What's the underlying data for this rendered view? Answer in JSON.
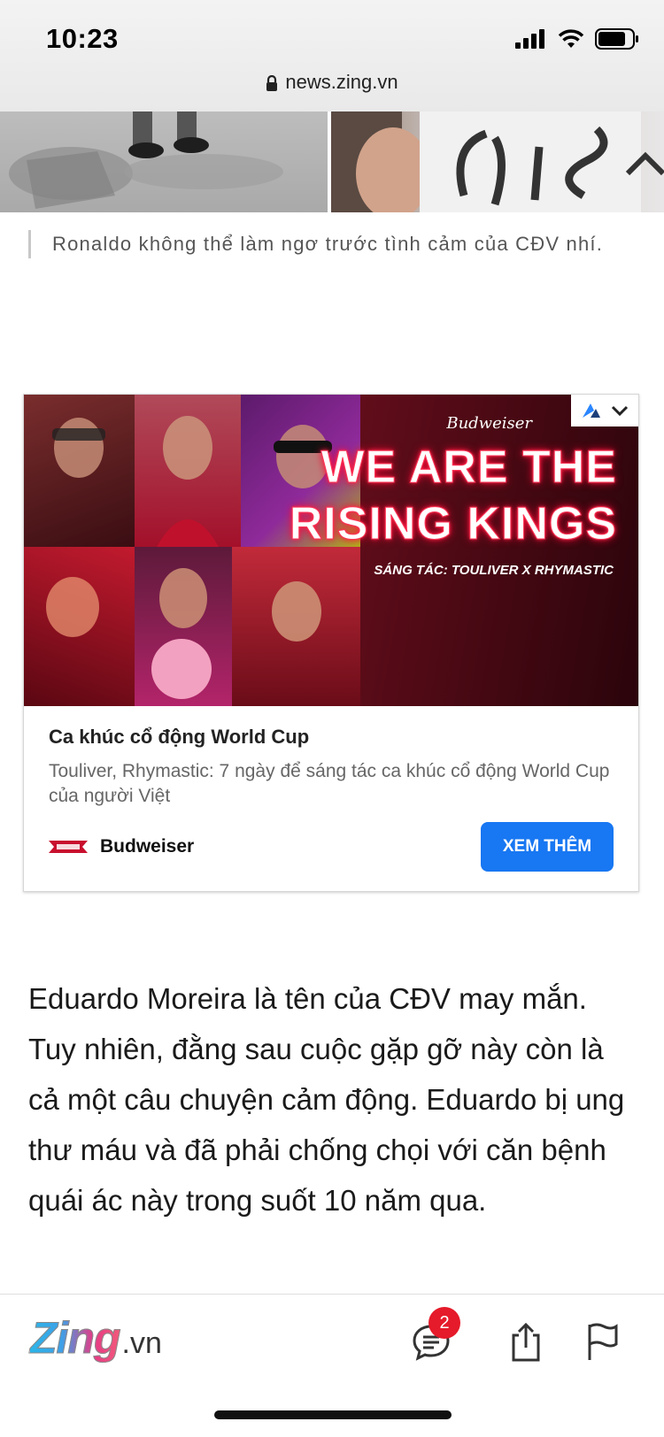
{
  "status_bar": {
    "time": "10:23"
  },
  "browser": {
    "url": "news.zing.vn"
  },
  "caption": "Ronaldo không thể làm ngơ trước tình cảm của CĐV nhí.",
  "ad": {
    "image_brand": "Budweiser",
    "image_title_line1": "WE ARE THE",
    "image_title_line2": "RISING KINGS",
    "image_credit": "SÁNG TÁC: TOULIVER X RHYMASTIC",
    "headline": "Ca khúc cổ động World Cup",
    "description": "Touliver, Rhymastic: 7 ngày để sáng tác ca khúc cổ động World Cup của người Việt",
    "advertiser": "Budweiser",
    "cta": "XEM THÊM",
    "cta_color": "#1877f2"
  },
  "article": {
    "paragraph": "Eduardo Moreira là tên của CĐV may mắn. Tuy nhiên, đằng sau cuộc gặp gỡ này còn là cả một câu chuyện cảm động. Eduardo bị ung thư máu và đã phải chống chọi với căn bệnh quái ác này trong suốt 10 năm qua."
  },
  "bottom_bar": {
    "logo_main": "Zing",
    "logo_suffix": ".vn",
    "comment_count": "2"
  },
  "icons": [
    "lock-icon",
    "signal-icon",
    "wifi-icon",
    "battery-icon",
    "ad-choices-icon",
    "chevron-down-icon",
    "comment-icon",
    "share-icon",
    "flag-icon"
  ]
}
